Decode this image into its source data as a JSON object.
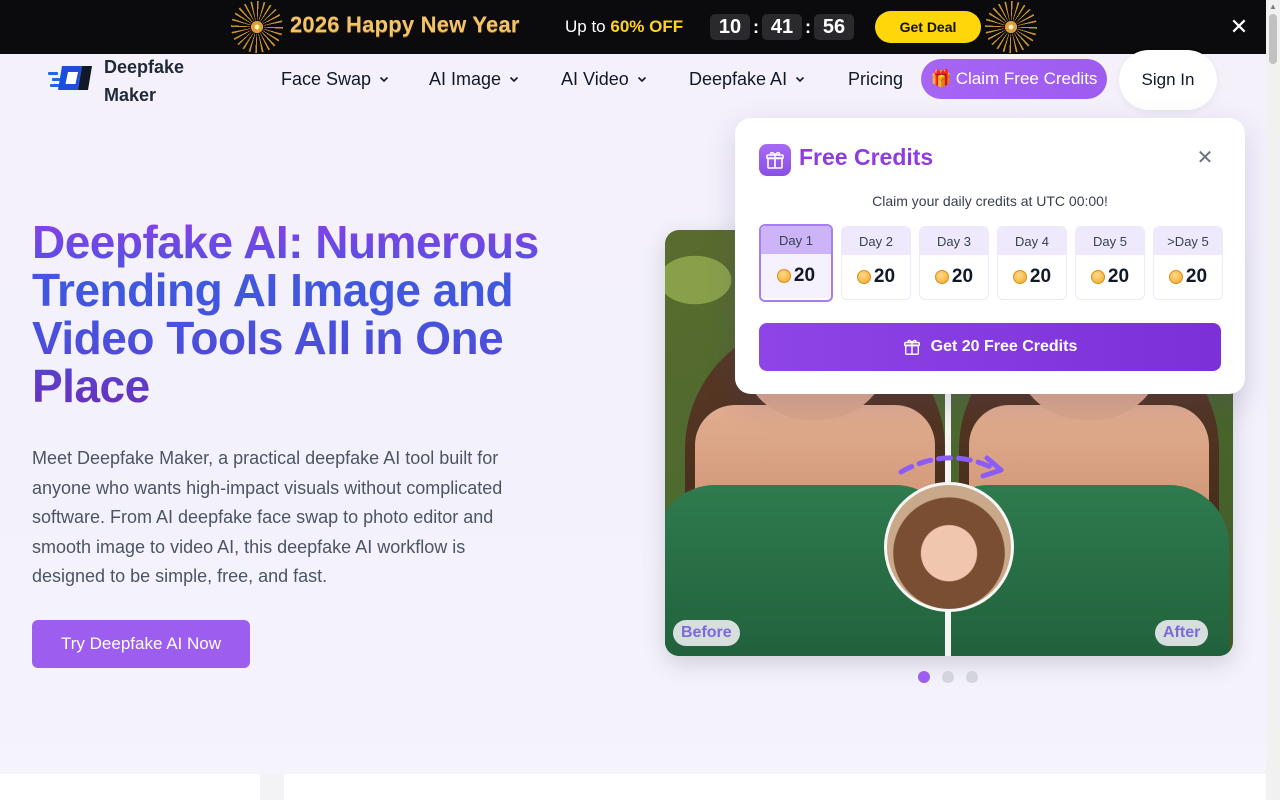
{
  "promo": {
    "title": "2026 Happy New Year",
    "offer_prefix": "Up to ",
    "offer_highlight": "60% OFF",
    "countdown": [
      "10",
      "41",
      "56"
    ],
    "deal_label": "Get Deal",
    "close_icon": "close-icon"
  },
  "nav": {
    "logo_text": "Deepfake Maker",
    "items": [
      {
        "label": "Face Swap",
        "dropdown": true
      },
      {
        "label": "AI Image",
        "dropdown": true
      },
      {
        "label": "AI Video",
        "dropdown": true
      },
      {
        "label": "Deepfake AI",
        "dropdown": true
      },
      {
        "label": "Pricing",
        "dropdown": false
      }
    ],
    "claim_label": "Claim Free Credits",
    "claim_icon": "🎁",
    "signin_label": "Sign In"
  },
  "hero": {
    "title": "Deepfake AI: Numerous Trending AI Image and Video Tools All in One Place",
    "description": "Meet Deepfake Maker, a practical deepfake AI tool built for anyone who wants high-impact visuals without complicated software. From AI deepfake face swap to photo editor and smooth image to video AI, this deepfake AI workflow is designed to be simple, free, and fast.",
    "cta_label": "Try Deepfake AI Now"
  },
  "showcase": {
    "before_label": "Before",
    "after_label": "After",
    "slides": 3,
    "active_slide": 0
  },
  "credits": {
    "title": "Free Credits",
    "subtitle": "Claim your daily credits at UTC 00:00!",
    "days": [
      {
        "label": "Day 1",
        "amount": "20",
        "active": true
      },
      {
        "label": "Day 2",
        "amount": "20",
        "active": false
      },
      {
        "label": "Day 3",
        "amount": "20",
        "active": false
      },
      {
        "label": "Day 4",
        "amount": "20",
        "active": false
      },
      {
        "label": "Day 5",
        "amount": "20",
        "active": false
      },
      {
        "label": ">Day 5",
        "amount": "20",
        "active": false
      }
    ],
    "button_label": "Get 20 Free Credits"
  },
  "colors": {
    "accent": "#9d5ef0",
    "deal_yellow": "#ffd60a",
    "title_purple": "#8e3ce0"
  }
}
